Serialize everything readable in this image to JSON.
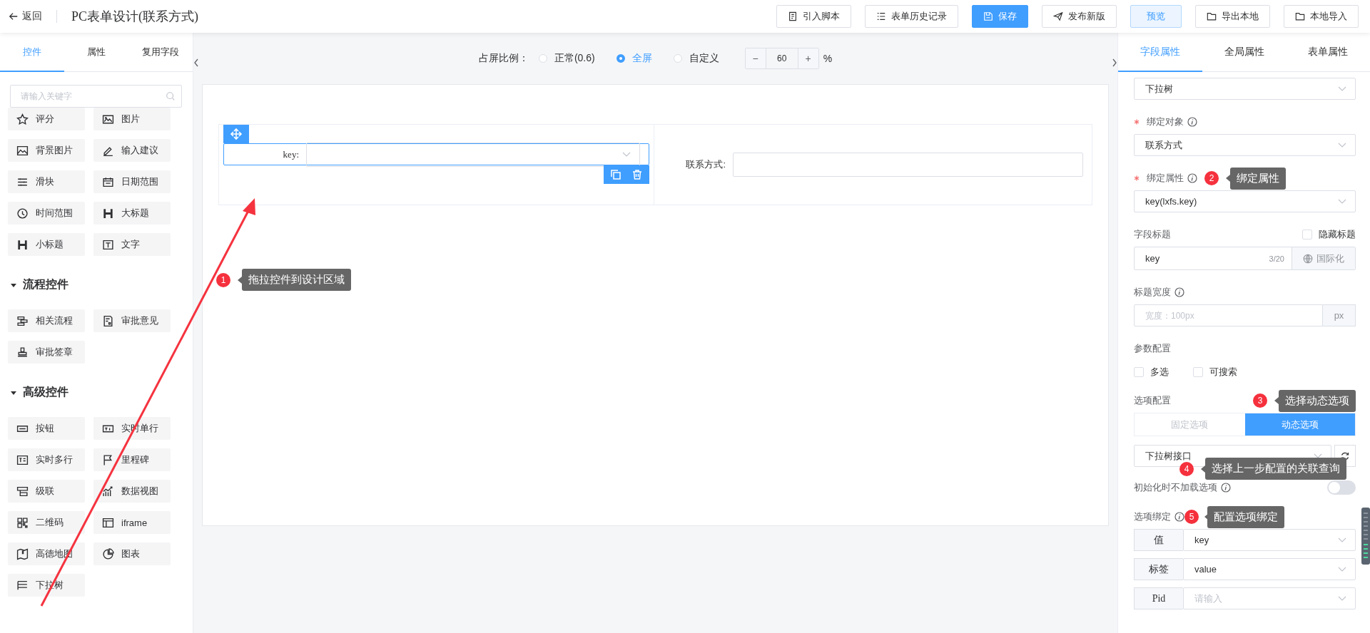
{
  "topbar": {
    "back": "返回",
    "title": "PC表单设计(联系方式)",
    "buttons": [
      {
        "label": "引入脚本",
        "kind": "default"
      },
      {
        "label": "表单历史记录",
        "kind": "default"
      },
      {
        "label": "保存",
        "kind": "primary"
      },
      {
        "label": "发布新版",
        "kind": "default"
      },
      {
        "label": "预览",
        "kind": "light"
      },
      {
        "label": "导出本地",
        "kind": "default"
      },
      {
        "label": "本地导入",
        "kind": "default"
      }
    ]
  },
  "left_panel": {
    "tabs": [
      {
        "label": "控件",
        "selected": true
      },
      {
        "label": "属性",
        "selected": false
      },
      {
        "label": "复用字段",
        "selected": false
      }
    ],
    "search": {
      "placeholder": "请输入关键字"
    },
    "items": [
      "评分",
      "图片",
      "背景图片",
      "输入建议",
      "滑块",
      "日期范围",
      "时间范围",
      "大标题",
      "小标题",
      "文字"
    ],
    "sections": [
      {
        "title": "流程控件",
        "expanded": true,
        "items": [
          "相关流程",
          "审批意见",
          "审批签章"
        ]
      },
      {
        "title": "高级控件",
        "expanded": true,
        "items": [
          "按钮",
          "实时单行",
          "实时多行",
          "里程碑",
          "级联",
          "数据视图",
          "二维码",
          "iframe",
          "高德地图",
          "图表",
          "下拉树"
        ]
      }
    ]
  },
  "canvas": {
    "ratio_label": "占屏比例：",
    "ratios": [
      {
        "label": "正常(0.6)",
        "selected": false
      },
      {
        "label": "全屏",
        "selected": true
      },
      {
        "label": "自定义",
        "selected": false
      }
    ],
    "stepper": {
      "minus": "−",
      "value": "60",
      "plus": "+",
      "unit": "%"
    },
    "fields": [
      {
        "label": "key:",
        "kind": "select",
        "selected": true
      },
      {
        "label": "联系方式:",
        "kind": "input",
        "selected": false
      }
    ],
    "callout": {
      "number": "1",
      "text": "拖拉控件到设计区域"
    }
  },
  "right_panel": {
    "tabs": [
      {
        "label": "字段属性",
        "selected": true
      },
      {
        "label": "全局属性",
        "selected": false
      },
      {
        "label": "表单属性",
        "selected": false
      }
    ],
    "component_type": {
      "value": "下拉树"
    },
    "bind_object": {
      "label": "绑定对象",
      "required": true,
      "value": "联系方式"
    },
    "bind_attr": {
      "label": "绑定属性",
      "required": true,
      "value": "key(lxfs.key)",
      "callout": {
        "number": "2",
        "text": "绑定属性"
      }
    },
    "field_title": {
      "label": "字段标题",
      "hide_title": {
        "label": "隐藏标题",
        "checked": false
      },
      "value": "key",
      "counter": "3/20",
      "i18n": "国际化"
    },
    "title_width": {
      "label": "标题宽度",
      "placeholder": "宽度：100px",
      "unit": "px"
    },
    "params": {
      "label": "参数配置",
      "options": [
        {
          "label": "多选",
          "checked": false
        },
        {
          "label": "可搜索",
          "checked": false
        }
      ]
    },
    "option_config": {
      "label": "选项配置",
      "callout": {
        "number": "3",
        "text": "选择动态选项"
      },
      "modes": [
        {
          "label": "固定选项",
          "selected": false
        },
        {
          "label": "动态选项",
          "selected": true
        }
      ],
      "source": "下拉树接口",
      "source_callout": {
        "number": "4",
        "text": "选择上一步配置的关联查询"
      }
    },
    "no_preload": {
      "label": "初始化时不加载选项",
      "on": false
    },
    "option_binding": {
      "label": "选项绑定",
      "callout": {
        "number": "5",
        "text": "配置选项绑定"
      },
      "rows": [
        {
          "label": "值",
          "value": "key"
        },
        {
          "label": "标签",
          "value": "value"
        },
        {
          "label": "Pid",
          "placeholder": "请输入"
        }
      ]
    }
  }
}
